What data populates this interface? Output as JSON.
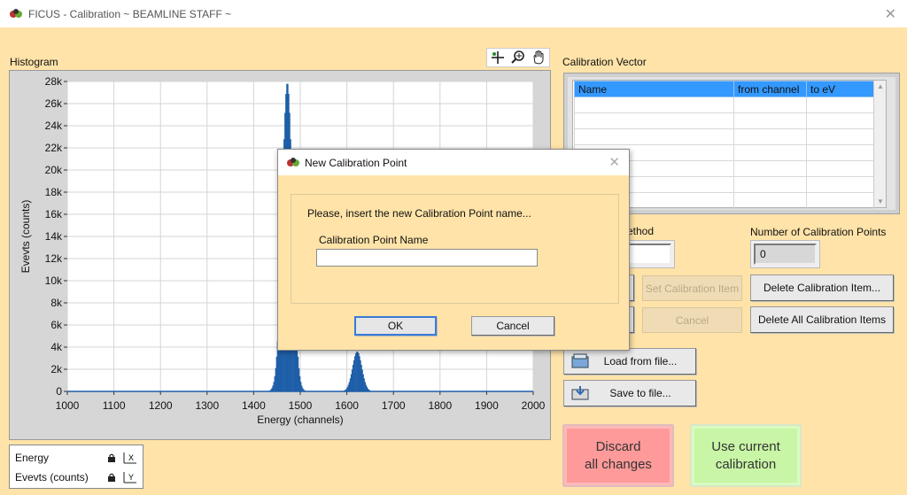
{
  "window": {
    "title": "FICUS - Calibration ~ BEAMLINE STAFF ~"
  },
  "histogram": {
    "label": "Histogram",
    "toolbar_icons": [
      "crosshair-icon",
      "zoom-icon",
      "pan-hand-icon"
    ]
  },
  "chart_data": {
    "type": "bar",
    "title": "",
    "xlabel": "Energy (channels)",
    "ylabel": "Evevts (counts)",
    "xlim": [
      1000,
      2000
    ],
    "ylim": [
      0,
      28000
    ],
    "xticks": [
      1000,
      1100,
      1200,
      1300,
      1400,
      1500,
      1600,
      1700,
      1800,
      1900,
      2000
    ],
    "yticks": [
      0,
      2000,
      4000,
      6000,
      8000,
      10000,
      12000,
      14000,
      16000,
      18000,
      20000,
      22000,
      24000,
      26000,
      28000
    ],
    "ytick_labels": [
      "0",
      "2k",
      "4k",
      "6k",
      "8k",
      "10k",
      "12k",
      "14k",
      "16k",
      "18k",
      "20k",
      "22k",
      "24k",
      "26k",
      "28k"
    ],
    "grid": true,
    "color": "#1f5fa8",
    "peaks": [
      {
        "center": 1472,
        "height": 27900,
        "sigma": 11
      },
      {
        "center": 1622,
        "height": 3600,
        "sigma": 10
      }
    ]
  },
  "legend": {
    "rows": [
      {
        "label": "Energy",
        "scale_label": "X"
      },
      {
        "label": "Evevts (counts)",
        "scale_label": "Y"
      }
    ]
  },
  "calibration_vector": {
    "label": "Calibration Vector",
    "columns": [
      "Name",
      "from channel",
      "to eV"
    ],
    "rows": 7
  },
  "method": {
    "label_partial": "ethod",
    "value": ""
  },
  "num_points": {
    "label": "Number of Calibration Points",
    "value": "0"
  },
  "buttons": {
    "set_item": "Set Calibration Item",
    "cancel": "Cancel",
    "delete_item": "Delete Calibration Item...",
    "delete_all": "Delete All Calibration Items",
    "load": "Load from file...",
    "save": "Save to file...",
    "discard": "Discard\nall changes",
    "use_current": "Use current\ncalibration"
  },
  "dialog": {
    "title": "New Calibration Point",
    "prompt": "Please, insert the new Calibration Point name...",
    "field_label": "Calibration Point Name",
    "field_value": "",
    "ok": "OK",
    "cancel": "Cancel"
  }
}
